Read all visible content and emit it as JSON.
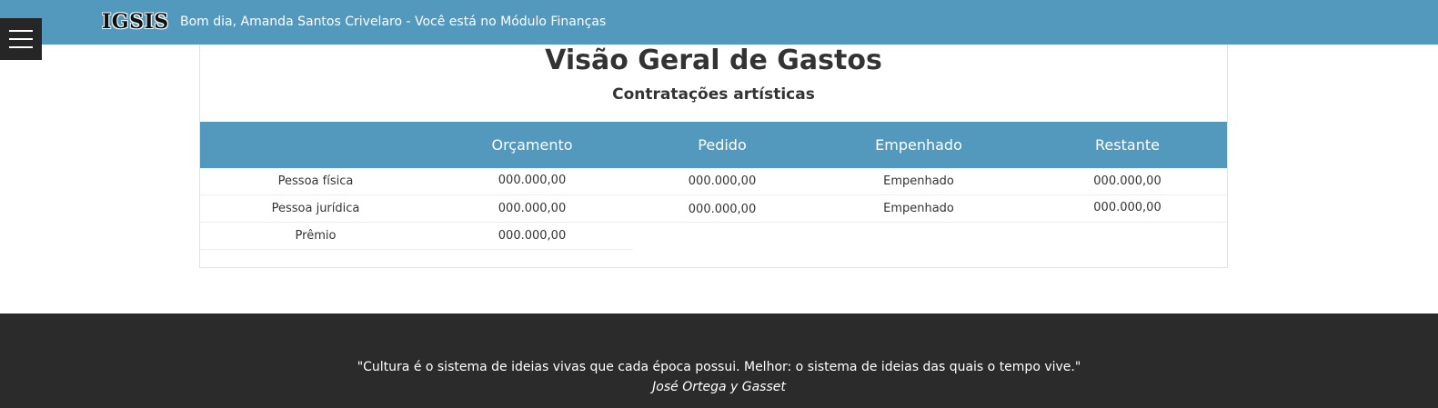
{
  "header": {
    "brand": "IGSIS",
    "greeting": "Bom dia, Amanda Santos Crivelaro - Você está no Módulo Finanças"
  },
  "menu": {
    "icon": "hamburger-menu-icon"
  },
  "main": {
    "title": "Visão Geral de Gastos",
    "subtitle": "Contratações artísticas",
    "table": {
      "columns": [
        "",
        "Orçamento",
        "Pedido",
        "Empenhado",
        "Restante"
      ],
      "rows": [
        {
          "label": "Pessoa física",
          "orcamento": "000.000,00",
          "pedido": "000.000,00",
          "empenhado": "Empenhado",
          "restante": "000.000,00"
        },
        {
          "label": "Pessoa jurídica",
          "orcamento": "000.000,00",
          "pedido": "000.000,00",
          "empenhado": "Empenhado",
          "restante": "000.000,00"
        },
        {
          "label": "Prêmio",
          "orcamento": "000.000,00"
        }
      ]
    }
  },
  "footer": {
    "quote": "\"Cultura é o sistema de ideias vivas que cada época possui. Melhor: o sistema de ideias das quais o tempo vive.\"",
    "author": "José Ortega y Gasset"
  },
  "colors": {
    "header_bg": "#5299bd",
    "menu_bg": "#262626",
    "footer_bg": "#2b2b2b"
  }
}
